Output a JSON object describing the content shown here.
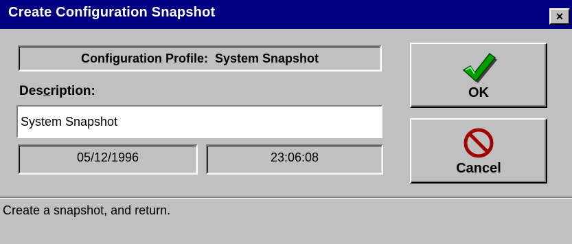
{
  "window": {
    "title": "Create Configuration Snapshot",
    "close_label": "×"
  },
  "profile": {
    "text": "Configuration Profile:  System Snapshot"
  },
  "description": {
    "label_prefix": "Des",
    "label_underlined": "c",
    "label_suffix": "ription:",
    "value": "System Snapshot"
  },
  "date": "05/12/1996",
  "time": "23:06:08",
  "buttons": {
    "ok_label": "OK",
    "ok_icon": "checkmark-icon",
    "cancel_label": "Cancel",
    "cancel_icon": "no-symbol-icon"
  },
  "status": {
    "text": "Create a snapshot, and return."
  },
  "colors": {
    "titlebar": "#000080",
    "face": "#c0c0c0",
    "check_green": "#00a000",
    "cancel_red": "#a00000"
  }
}
